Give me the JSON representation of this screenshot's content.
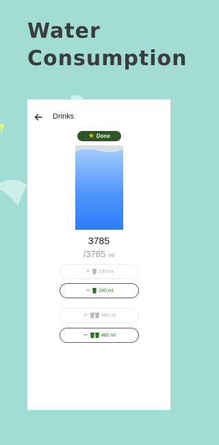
{
  "promo": {
    "line1": "Water",
    "line2": "Consumption"
  },
  "header": {
    "back_icon": "arrow-left-icon",
    "title": "Drinks"
  },
  "status_badge": {
    "icon": "star-icon",
    "label": "Done"
  },
  "progress": {
    "fill_fraction": 0.92,
    "consumed": "3785",
    "goal": "/3785",
    "unit": "ml"
  },
  "buttons": {
    "add_240": {
      "sign": "+",
      "label": "240 ml",
      "icon": "cup-icon"
    },
    "remove_240": {
      "sign": "−",
      "label": "240 ml",
      "icon": "cup-icon"
    },
    "add_480": {
      "sign": "+",
      "label": "480 ml",
      "icon": "two-cups-icon"
    },
    "remove_480": {
      "sign": "−",
      "label": "480 ml",
      "icon": "two-cups-icon"
    }
  },
  "colors": {
    "background": "#a1ddd4",
    "badge": "#2b5824",
    "water": "#4f93fb",
    "accent_green": "#2e6f2a"
  }
}
